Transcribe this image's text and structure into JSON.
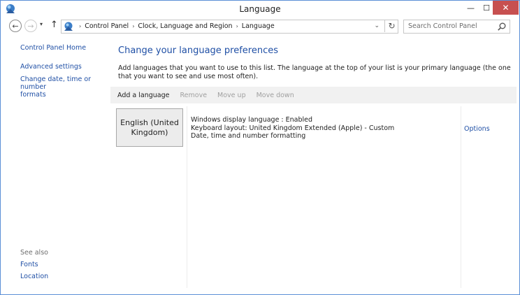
{
  "window": {
    "title": "Language",
    "minimize_label": "—",
    "maximize_label": "☐",
    "close_label": "✕"
  },
  "navigation": {
    "back_glyph": "←",
    "forward_glyph": "→",
    "recent_glyph": "▾",
    "up_glyph": "↑",
    "breadcrumb_separator": "›",
    "breadcrumbs": [
      "Control Panel",
      "Clock, Language and Region",
      "Language"
    ],
    "address_dropdown_glyph": "⌄",
    "refresh_glyph": "↻",
    "search_placeholder": "Search Control Panel"
  },
  "sidebar": {
    "home_link": "Control Panel Home",
    "advanced_settings": "Advanced settings",
    "change_date_line1": "Change date, time or number",
    "change_date_line2": "formats",
    "see_also_label": "See also",
    "fonts_link": "Fonts",
    "location_link": "Location"
  },
  "main": {
    "heading": "Change your language preferences",
    "description": "Add languages that you want to use to this list. The language at the top of your list is your primary language (the one that you want to see and use most often).",
    "toolbar": {
      "add_language": "Add a language",
      "remove": "Remove",
      "move_up": "Move up",
      "move_down": "Move down"
    },
    "languages": [
      {
        "name_line1": "English (United",
        "name_line2": "Kingdom)",
        "display_language": "Windows display language : Enabled",
        "keyboard_layout": "Keyboard layout: United Kingdom Extended (Apple) - Custom",
        "formatting": "Date, time and number formatting",
        "options_label": "Options"
      }
    ]
  },
  "colors": {
    "link": "#1f4fa5",
    "close_button": "#c75050",
    "window_border": "#5b8fd6",
    "toolbar_bg": "#f1f1f1"
  },
  "icons": {
    "app": "control-panel-icon",
    "search": "search-icon"
  }
}
